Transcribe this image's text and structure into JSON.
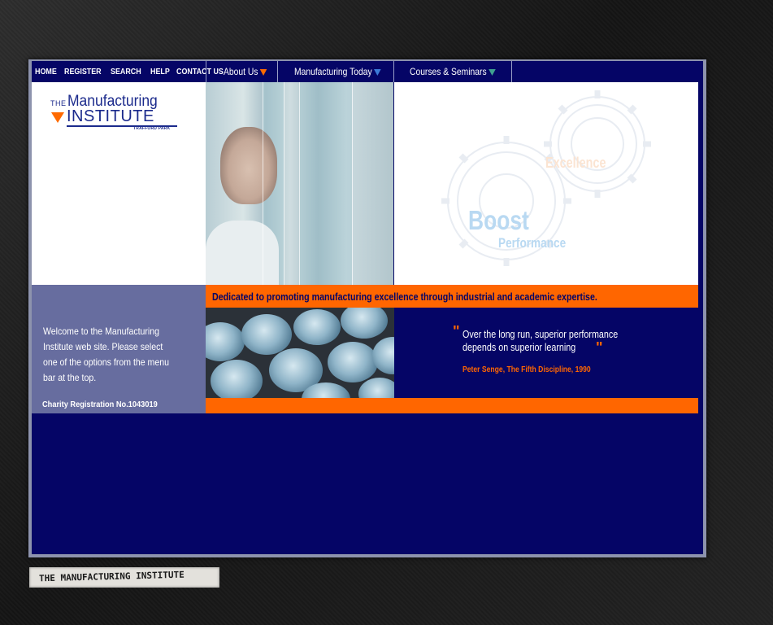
{
  "nav": {
    "links": [
      "HOME",
      "REGISTER",
      "SEARCH",
      "HELP",
      "CONTACT US"
    ],
    "menus": [
      "About Us",
      "Manufacturing Today",
      "Courses & Seminars"
    ]
  },
  "logo": {
    "the": "THE",
    "manufacturing": "Manufacturing",
    "institute": "INSTITUTE",
    "location": "TRAFFORD PARK"
  },
  "hero": {
    "boost": "Boost",
    "performance": "Performance",
    "excellence": "Excellence"
  },
  "tagline": "Dedicated to promoting manufacturing excellence through industrial and academic expertise.",
  "welcome": "Welcome to the Manufacturing Institute web site. Please select one of the options from the menu bar at the top.",
  "charity": "Charity Registration No.1043019",
  "quote": {
    "text": "Over the long run, superior performance depends on superior learning",
    "citation": "Peter Senge, The Fifth Discipline, 1990"
  },
  "footer_stamp": "THE MANUFACTURING INSTITUTE",
  "colors": {
    "navy": "#050566",
    "orange": "#ff6600",
    "lavender": "#676d9f"
  }
}
